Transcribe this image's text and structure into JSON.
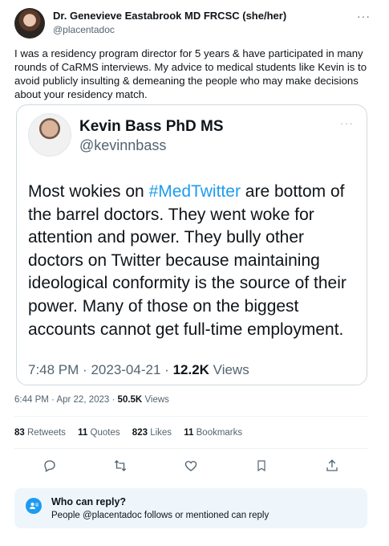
{
  "author": {
    "name": "Dr. Genevieve Eastabrook MD FRCSC (she/her)",
    "handle": "@placentadoc",
    "more": "···"
  },
  "tweet_text": "I was a residency program director for 5 years & have participated in many rounds of CaRMS interviews. My advice to medical students like Kevin is to avoid publicly insulting & demeaning the people who may make decisions about your residency match.",
  "quote": {
    "name": "Kevin Bass PhD MS",
    "handle": "@kevinnbass",
    "more": "···",
    "text_before": "Most wokies on ",
    "hashtag": "#MedTwitter",
    "text_after": " are bottom of the barrel doctors. They went woke for attention and power. They bully other doctors on Twitter because maintaining ideological conformity is the source of their power. Many of those on the biggest accounts cannot get full-time employment.",
    "time": "7:48 PM",
    "date": "2023-04-21",
    "views_count": "12.2K",
    "views_label": "Views",
    "sep": "·"
  },
  "meta": {
    "time": "6:44 PM",
    "date": "Apr 22, 2023",
    "views_count": "50.5K",
    "views_label": "Views",
    "sep": "·"
  },
  "stats": [
    {
      "num": "83",
      "label": "Retweets"
    },
    {
      "num": "11",
      "label": "Quotes"
    },
    {
      "num": "823",
      "label": "Likes"
    },
    {
      "num": "11",
      "label": "Bookmarks"
    }
  ],
  "actions": [
    "reply-icon",
    "retweet-icon",
    "like-icon",
    "bookmark-icon",
    "share-icon"
  ],
  "who_can_reply": {
    "title": "Who can reply?",
    "subtitle": "People @placentadoc follows or mentioned can reply"
  },
  "colors": {
    "link": "#1d9bf0",
    "secondary_text": "#536471",
    "reply_box_bg": "#eef6fc"
  }
}
